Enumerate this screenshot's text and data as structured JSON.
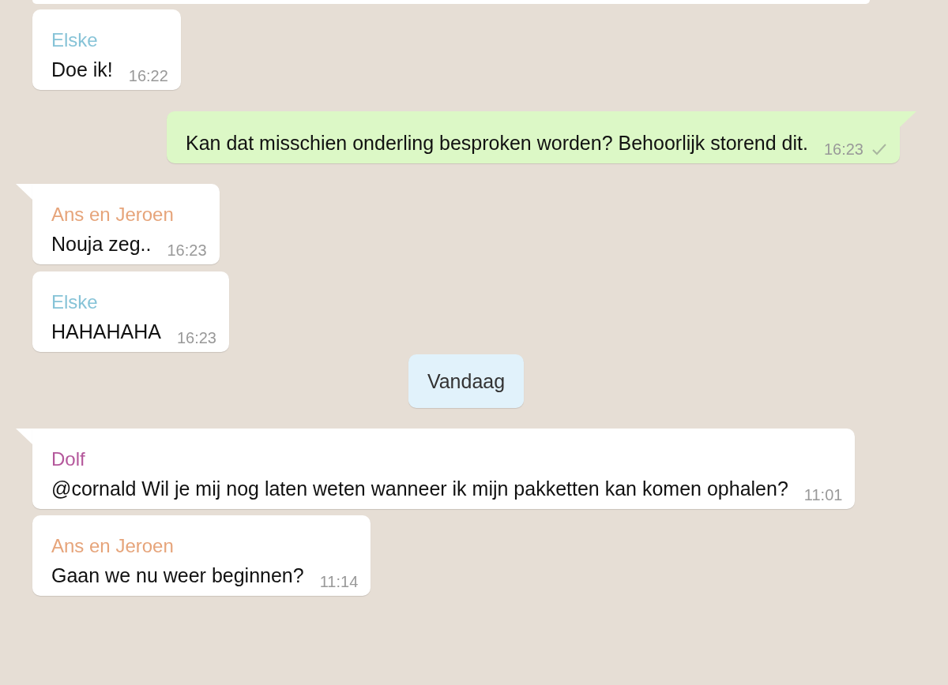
{
  "messages": [
    {
      "kind": "clipped"
    },
    {
      "kind": "incoming",
      "tail": false,
      "sender": "Elske",
      "color": "#86c3d7",
      "text": "Doe ik!",
      "time": "16:22"
    },
    {
      "kind": "outgoing",
      "tail": true,
      "text": "Kan dat misschien onderling besproken worden? Behoorlijk storend dit.",
      "time": "16:23",
      "delivered": true
    },
    {
      "kind": "incoming",
      "tail": true,
      "sender": "Ans en Jeroen",
      "color": "#e6a47a",
      "text": "Nouja zeg..",
      "time": "16:23"
    },
    {
      "kind": "incoming",
      "tail": false,
      "sender": "Elske",
      "color": "#86c3d7",
      "text": "HAHAHAHA",
      "time": "16:23"
    },
    {
      "kind": "date",
      "text": "Vandaag"
    },
    {
      "kind": "incoming",
      "tail": true,
      "sender": "Dolf",
      "color": "#b4579b",
      "text": "@cornald Wil je mij nog laten weten wanneer ik mijn pakketten kan komen ophalen?",
      "time": "11:01"
    },
    {
      "kind": "incoming",
      "tail": false,
      "sender": "Ans en Jeroen",
      "color": "#e6a47a",
      "text": "Gaan we nu weer beginnen?",
      "time": "11:14"
    }
  ]
}
